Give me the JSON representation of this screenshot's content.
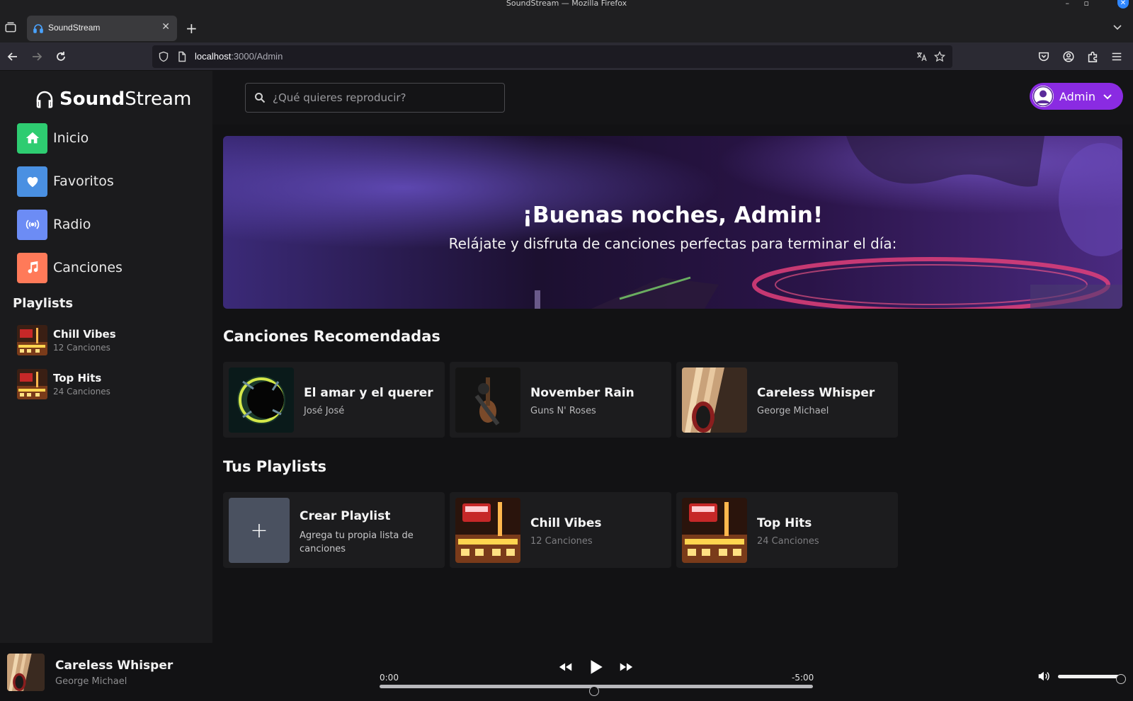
{
  "window": {
    "title": "SoundStream — Mozilla Firefox"
  },
  "browser": {
    "tab_title": "SoundStream",
    "url_host": "localhost",
    "url_rest": ":3000/Admin"
  },
  "app": {
    "logo_bold": "Sound",
    "logo_light": "Stream",
    "menu": [
      {
        "label": "Inicio",
        "color": "#2ecc71",
        "icon": "home-icon"
      },
      {
        "label": "Favoritos",
        "color": "#4a90e2",
        "icon": "heart-icon"
      },
      {
        "label": "Radio",
        "color": "#6c8cf5",
        "icon": "radio-icon"
      },
      {
        "label": "Canciones",
        "color": "#ff7a59",
        "icon": "music-note-icon"
      }
    ],
    "playlists_heading": "Playlists",
    "sidebar_playlists": [
      {
        "name": "Chill Vibes",
        "count": "12 Canciones"
      },
      {
        "name": "Top Hits",
        "count": "24 Canciones"
      }
    ],
    "search_placeholder": "¿Qué quieres reproducir?",
    "user_name": "Admin",
    "accent": "#8a2be2"
  },
  "hero": {
    "title": "¡Buenas noches, Admin!",
    "subtitle": "Relájate y disfruta de canciones perfectas para terminar el día:"
  },
  "recommended": {
    "heading": "Canciones Recomendadas",
    "songs": [
      {
        "title": "El amar y el querer",
        "artist": "José José"
      },
      {
        "title": "November Rain",
        "artist": "Guns N' Roses"
      },
      {
        "title": "Careless Whisper",
        "artist": "George Michael"
      }
    ]
  },
  "your_playlists": {
    "heading": "Tus Playlists",
    "create": {
      "title": "Crear Playlist",
      "desc": "Agrega tu propia lista de canciones"
    },
    "items": [
      {
        "name": "Chill Vibes",
        "count": "12 Canciones"
      },
      {
        "name": "Top Hits",
        "count": "24 Canciones"
      }
    ]
  },
  "player": {
    "title": "Careless Whisper",
    "artist": "George Michael",
    "elapsed": "0:00",
    "remaining": "-5:00",
    "progress": 0.0,
    "volume": 1.0
  }
}
